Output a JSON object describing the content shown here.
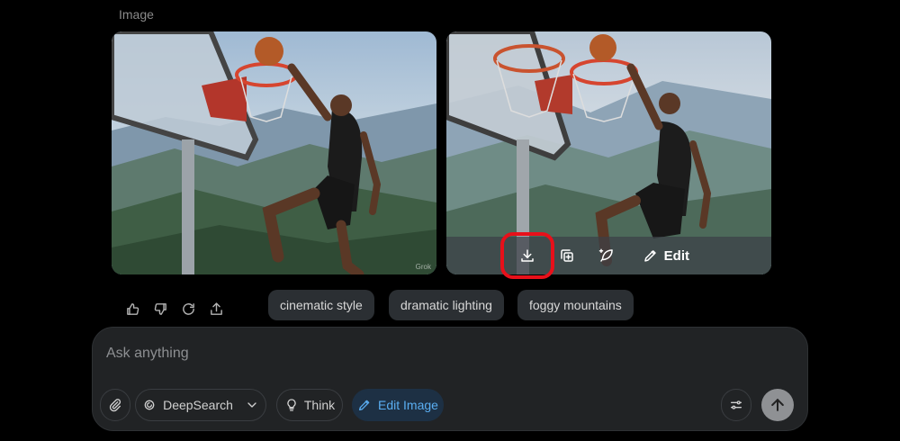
{
  "section_label": "Image",
  "images": {
    "left": {
      "watermark": "Grok"
    },
    "right": {
      "overlay": {
        "edit_label": "Edit"
      }
    }
  },
  "suggestions": [
    "cinematic style",
    "dramatic lighting",
    "foggy mountains"
  ],
  "composer": {
    "placeholder": "Ask anything",
    "deepsearch_label": "DeepSearch",
    "think_label": "Think",
    "edit_image_label": "Edit Image"
  },
  "colors": {
    "highlight": "#e8101a",
    "edit_image_accent": "#5aaef2"
  },
  "icons": {
    "overlay": [
      "download-icon",
      "duplicate-icon",
      "animate-icon",
      "pencil-icon"
    ],
    "actions": [
      "thumbs-up-icon",
      "thumbs-down-icon",
      "regenerate-icon",
      "share-icon"
    ]
  }
}
